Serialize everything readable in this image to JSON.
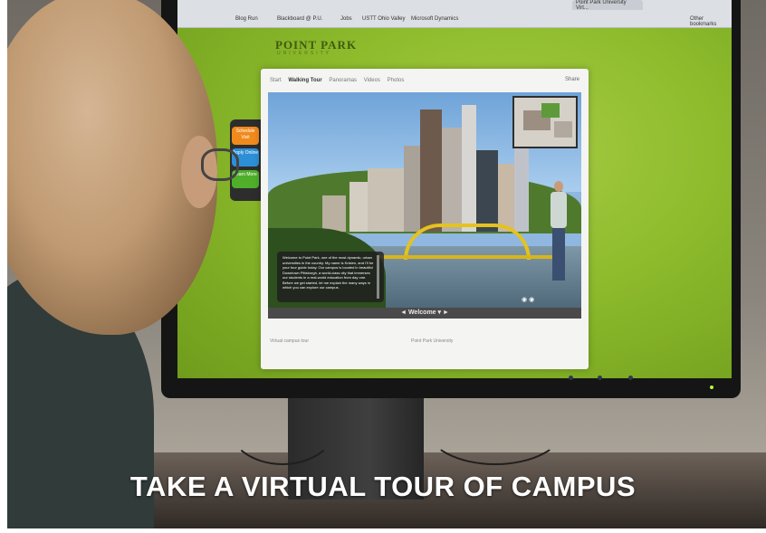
{
  "browser": {
    "tabs": [
      "Point Park University Virt..."
    ],
    "bookmarks": [
      "Blog Run",
      "Blackboard @ P.U.",
      "Jobs",
      "USTT Ohio Valley",
      "Microsoft Dynamics",
      "Other bookmarks"
    ]
  },
  "site": {
    "brand": "POINT PARK",
    "brand_sub": "UNIVERSITY",
    "side_tabs": [
      "Schedule Visit",
      "Apply Online",
      "Learn More"
    ],
    "nav": [
      "Start",
      "Walking Tour",
      "Panoramas",
      "Videos",
      "Photos"
    ],
    "share_label": "Share",
    "welcome_text": "Welcome to Point Park, one of the most dynamic, urban universities in the country. My name is Kristen, and I'll be your tour guide today. Our campus is located in beautiful Downtown Pittsburgh, a world-class city that immerses our students in a real-world education from day one. Before we get started, let me explain the many ways in which you can explore our campus.",
    "caption": "Welcome",
    "footer_left": "Virtual campus tour",
    "footer_center": "Point Park University"
  },
  "headline": "TAKE A VIRTUAL TOUR OF CAMPUS",
  "colors": {
    "screen_green": "#8dbb2c",
    "schedule_tab": "#f08a1c",
    "apply_tab": "#2d8fd6",
    "learn_tab": "#4fae2a",
    "bridge": "#e6c21e"
  }
}
